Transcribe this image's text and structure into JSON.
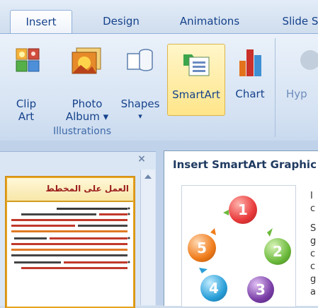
{
  "tabs": [
    {
      "label": "Insert",
      "active": true
    },
    {
      "label": "Design"
    },
    {
      "label": "Animations"
    },
    {
      "label": "Slide S"
    }
  ],
  "illustrations": {
    "group_label": "Illustrations",
    "clip_art": {
      "line1": "Clip",
      "line2": "Art"
    },
    "photo_album": {
      "line1": "Photo",
      "line2": "Album ▾"
    },
    "shapes": {
      "line1": "Shapes",
      "line2": "▾"
    },
    "smartart": {
      "line1": "SmartArt"
    },
    "chart": {
      "line1": "Chart"
    }
  },
  "links": {
    "hyperlink_partial": "Hyp"
  },
  "pane": {
    "close": "×"
  },
  "slide_thumb": {
    "title": "العمل على المخطط"
  },
  "dialog": {
    "title": "Insert SmartArt Graphic",
    "preview_numbers": [
      "1",
      "2",
      "3",
      "4",
      "5"
    ],
    "side_letters": [
      "I",
      "c",
      "S",
      "g",
      "c",
      "c",
      "g",
      "a"
    ]
  },
  "colors": {
    "ball1": "#e8393a",
    "ball2": "#6cba3c",
    "ball3": "#7a3fa7",
    "ball4": "#2a9fd8",
    "ball5": "#f07c1b"
  }
}
